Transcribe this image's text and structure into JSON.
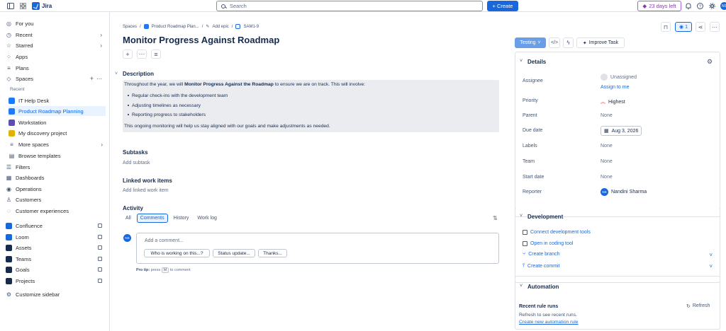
{
  "topbar": {
    "brand": "Jira",
    "search_placeholder": "Search",
    "create_label": "+ Create",
    "trial_label": "23 days left",
    "avatar": "NS"
  },
  "sidebar": {
    "items": [
      {
        "label": "For you",
        "icon": "person-circle-icon"
      },
      {
        "label": "Recent",
        "icon": "clock-icon"
      },
      {
        "label": "Starred",
        "icon": "star-icon"
      },
      {
        "label": "Apps",
        "icon": "apps-icon"
      },
      {
        "label": "Plans",
        "icon": "plans-icon"
      },
      {
        "label": "Spaces",
        "icon": "spaces-icon"
      }
    ],
    "recent_heading": "Recent",
    "spaces": [
      {
        "label": "IT Help Desk",
        "color": "#1d7afc"
      },
      {
        "label": "Product Roadmap Planning",
        "color": "#1d7afc"
      },
      {
        "label": "Workstation",
        "color": "#5e4db2"
      },
      {
        "label": "My discovery project",
        "color": "#e2b203"
      }
    ],
    "more_spaces": "More spaces",
    "browse_templates": "Browse templates",
    "items2": [
      {
        "label": "Filters",
        "icon": "filter-icon"
      },
      {
        "label": "Dashboards",
        "icon": "dashboard-icon"
      },
      {
        "label": "Operations",
        "icon": "operations-icon"
      },
      {
        "label": "Customers",
        "icon": "customers-icon"
      },
      {
        "label": "Customer experiences",
        "icon": "chat-icon"
      }
    ],
    "apps": [
      {
        "label": "Confluence",
        "color": "#1868db"
      },
      {
        "label": "Loom",
        "color": "#1868db"
      },
      {
        "label": "Assets",
        "color": "#172b4d"
      },
      {
        "label": "Teams",
        "color": "#172b4d"
      },
      {
        "label": "Goals",
        "color": "#172b4d"
      },
      {
        "label": "Projects",
        "color": "#172b4d"
      }
    ],
    "customize": "Customize sidebar"
  },
  "main": {
    "breadcrumbs": [
      "Spaces",
      "/",
      "Product Roadmap Plan...",
      "/",
      "Add epic",
      "/",
      "SAM1-9"
    ],
    "title": "Monitor Progress Against Roadmap",
    "description_heading": "Description",
    "desc_pre": "Throughout the year, we will ",
    "desc_bold": "Monitor Progress Against the Roadmap",
    "desc_post": " to ensure we are on track. This will involve:",
    "bullets": [
      "Regular check-ins with the development team",
      "Adjusting timelines as necessary",
      "Reporting progress to stakeholders"
    ],
    "desc_closing": "This ongoing monitoring will help us stay aligned with our goals and make adjustments as needed.",
    "subtasks_heading": "Subtasks",
    "add_subtask": "Add subtask",
    "linked_heading": "Linked work items",
    "add_linked": "Add linked work item",
    "activity_heading": "Activity",
    "tabs": [
      "All",
      "Comments",
      "History",
      "Work log"
    ],
    "comment_placeholder": "Add a comment...",
    "chips": [
      "Who is working on this...?",
      "Status update...",
      "Thanks..."
    ],
    "protip_bold": "Pro tip:",
    "protip_pre": " press ",
    "protip_key": "M",
    "protip_post": " to comment",
    "avatar": "NS"
  },
  "right": {
    "watch_count": "1",
    "status": "Testing",
    "improve": "Improve Task",
    "details_heading": "Details",
    "fields": [
      {
        "label": "Assignee",
        "value": "Unassigned"
      },
      {
        "label": "Priority",
        "value": "Highest"
      },
      {
        "label": "Parent",
        "value": "None"
      },
      {
        "label": "Due date",
        "value": "Aug 3, 2026"
      },
      {
        "label": "Labels",
        "value": "None"
      },
      {
        "label": "Team",
        "value": "None"
      },
      {
        "label": "Start date",
        "value": "None"
      },
      {
        "label": "Reporter",
        "value": "Nandini Sharma"
      }
    ],
    "assign_to_me": "Assign to me",
    "reporter_avatar": "NS",
    "development_heading": "Development",
    "dev_items": [
      "Connect development tools",
      "Open in coding tool",
      "Create branch",
      "Create commit"
    ],
    "automation_heading": "Automation",
    "recent_runs": "Recent rule runs",
    "refresh": "Refresh",
    "refresh_hint": "Refresh to see recent runs.",
    "create_rule": "Create new automation rule"
  }
}
